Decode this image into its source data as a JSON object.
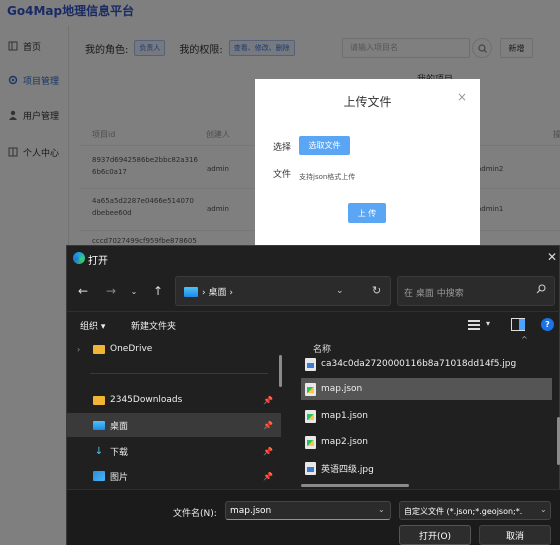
{
  "app": {
    "title": "Go4Map地理信息平台"
  },
  "sidebar": {
    "items": [
      {
        "label": "首页",
        "icon": "square-icon"
      },
      {
        "label": "项目管理",
        "icon": "gear-icon"
      },
      {
        "label": "用户管理",
        "icon": "user-icon"
      },
      {
        "label": "个人中心",
        "icon": "book-icon"
      }
    ],
    "active_index": 1
  },
  "rolebar": {
    "role_label": "我的角色:",
    "role_tag": "负责人",
    "perm_label": "我的权限:",
    "perm_tag": "查看、修改、删除",
    "search_placeholder": "请输入项目名",
    "add_label": "新增"
  },
  "table": {
    "section_title": "我的项目",
    "headers": [
      "项目id",
      "创建人",
      "操"
    ],
    "rows": [
      {
        "id_line1": "8937d6942586be2bbc82a316",
        "id_line2": "6b6c0a17",
        "creator": "admin",
        "member": "admin2"
      },
      {
        "id_line1": "4a65a5d2287e0466e514070",
        "id_line2": "dbebee60d",
        "creator": "admin",
        "member": "admin1"
      },
      {
        "id_line1": "cccd7027499cf959fbe878605",
        "id_line2": "",
        "creator": "",
        "member": ""
      }
    ]
  },
  "upload_modal": {
    "title": "上传文件",
    "close": "×",
    "select_label": "选择",
    "select_button": "选取文件",
    "file_label": "文件",
    "hint": "支持json格式上传",
    "upload_button": "上 传"
  },
  "file_dialog": {
    "title": "打开",
    "close": "✕",
    "address": "桌面",
    "search_placeholder": "在 桌面 中搜索",
    "organize": "组织 ▾",
    "new_folder": "新建文件夹",
    "left_items": [
      {
        "label": "OneDrive",
        "icon": "folder-icon"
      },
      {
        "label": "2345Downloads",
        "icon": "folder-icon"
      },
      {
        "label": "桌面",
        "icon": "desktop-icon"
      },
      {
        "label": "下载",
        "icon": "download-icon"
      },
      {
        "label": "图片",
        "icon": "pictures-icon"
      }
    ],
    "column_name": "名称",
    "files": [
      {
        "name": "ca34c0da2720000116b8a71018dd14f5.jpg",
        "type": "jpg"
      },
      {
        "name": "map.json",
        "type": "json"
      },
      {
        "name": "map1.json",
        "type": "json"
      },
      {
        "name": "map2.json",
        "type": "json"
      },
      {
        "name": "英语四级.jpg",
        "type": "jpg"
      }
    ],
    "selected_file_index": 1,
    "filename_label": "文件名(N):",
    "filename_value": "map.json",
    "filetype_value": "自定义文件 (*.json;*.geojson;*.",
    "open_button": "打开(O)",
    "cancel_button": "取消"
  },
  "colors": {
    "brand": "#3355c8",
    "accent": "#5aa6f5",
    "dialog_bg": "#202020"
  }
}
